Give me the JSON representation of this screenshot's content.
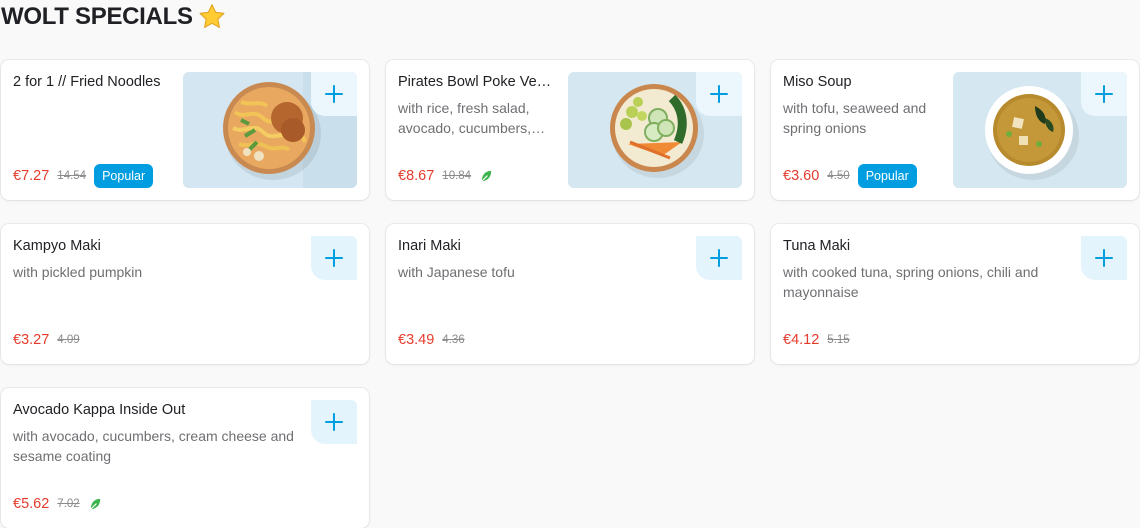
{
  "section": {
    "title": "WOLT SPECIALS"
  },
  "items": [
    {
      "name": "2 for 1 // Fried Noodles",
      "description": "",
      "price": "€7.27",
      "original_price": "14.54",
      "badge": "Popular"
    },
    {
      "name": "Pirates Bowl Poke Vegan",
      "description": "with rice, fresh salad, avocado, cucumbers, edamame and carrots",
      "price": "€8.67",
      "original_price": "10.84",
      "vegan": true
    },
    {
      "name": "Miso Soup",
      "description": "with tofu, seaweed and spring onions",
      "price": "€3.60",
      "original_price": "4.50",
      "badge": "Popular"
    },
    {
      "name": "Kampyo Maki",
      "description": "with pickled pumpkin",
      "price": "€3.27",
      "original_price": "4.09"
    },
    {
      "name": "Inari Maki",
      "description": "with Japanese tofu",
      "price": "€3.49",
      "original_price": "4.36"
    },
    {
      "name": "Tuna Maki",
      "description": "with cooked tuna, spring onions, chili and mayonnaise",
      "price": "€4.12",
      "original_price": "5.15"
    },
    {
      "name": "Avocado Kappa Inside Out",
      "description": "with avocado, cucumbers, cream cheese and sesame coating",
      "price": "€5.62",
      "original_price": "7.02",
      "vegan": true
    }
  ],
  "icons": {
    "title_icon": "star-icon",
    "add": "plus-icon",
    "diet": "vegan-leaf-icon"
  },
  "colors": {
    "accent": "#009de0",
    "price": "#e53b2c",
    "add_bg": "#e4f4fc",
    "vegan": "#3cb44b"
  }
}
